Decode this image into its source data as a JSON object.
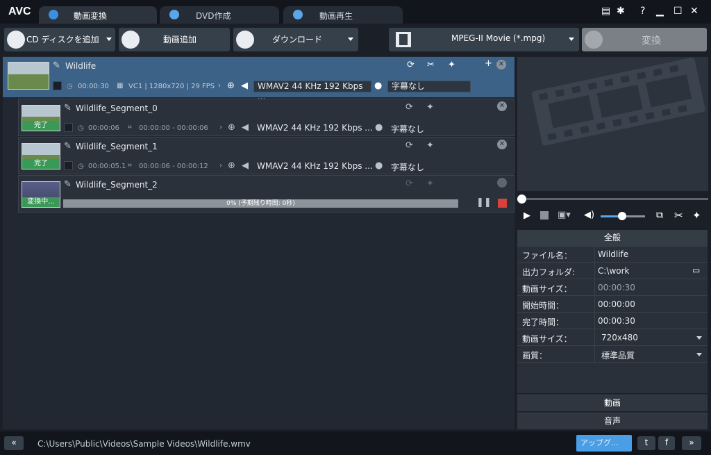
{
  "app": {
    "logo": "AVC"
  },
  "tabs": [
    {
      "label": "動画変換"
    },
    {
      "label": "DVD作成"
    },
    {
      "label": "動画再生"
    }
  ],
  "toolbar": {
    "add_cd": "CD ディスクを追加",
    "add_video": "動画追加",
    "download": "ダウンロード",
    "format": "MPEG-II Movie (*.mpg)",
    "convert": "変換"
  },
  "main_item": {
    "name": "Wildlife",
    "duration": "00:00:30",
    "video_info": "VC1 | 1280x720 | 29 FPS",
    "audio": "WMAV2 44 KHz 192 Kbps ...",
    "subtitle": "字幕なし"
  },
  "segments": [
    {
      "name": "Wildlife_Segment_0",
      "status": "完了",
      "duration": "00:00:06",
      "range": "00:00:00 - 00:00:06",
      "audio": "WMAV2 44 KHz 192 Kbps ...",
      "subtitle": "字幕なし"
    },
    {
      "name": "Wildlife_Segment_1",
      "status": "完了",
      "duration": "00:00:05.1",
      "range": "00:00:06 - 00:00:12",
      "audio": "WMAV2 44 KHz 192 Kbps ...",
      "subtitle": "字幕なし"
    },
    {
      "name": "Wildlife_Segment_2",
      "status": "変換中...",
      "progress_text": "0% (予期残り時間: 0秒)",
      "progress": 0
    }
  ],
  "props": {
    "header": "全般",
    "rows": [
      {
        "k": "ファイル名：",
        "v": "Wildlife"
      },
      {
        "k": "出力フォルダ:",
        "v": "C:\\work"
      },
      {
        "k": "動画サイズ：",
        "v": "00:00:30"
      },
      {
        "k": "開始時間：",
        "v": "00:00:00"
      },
      {
        "k": "完了時間：",
        "v": "00:00:30"
      },
      {
        "k": "動画サイズ：",
        "v": "720x480"
      },
      {
        "k": "画質：",
        "v": "標準品質"
      }
    ],
    "video_section": "動画",
    "audio_section": "音声"
  },
  "status": {
    "path": "C:\\Users\\Public\\Videos\\Sample Videos\\Wildlife.wmv",
    "upgrade": "アップグ..."
  },
  "colors": {
    "accent": "#5aa6e8",
    "selected_row": "#3c6288",
    "done": "#3b9957",
    "stop": "#d9413b"
  }
}
